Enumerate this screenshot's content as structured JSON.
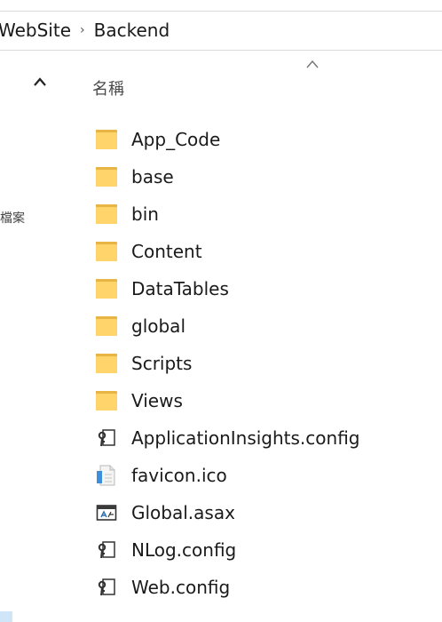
{
  "breadcrumb": {
    "items": [
      "WebSite",
      "Backend"
    ],
    "separator": "›"
  },
  "nav_pane": {
    "partial_text": "檔案",
    "scroll_up_icon": "chevron-up-icon"
  },
  "column": {
    "name_header": "名稱",
    "sort_icon": "sort-ascending-icon"
  },
  "files": [
    {
      "name": "App_Code",
      "type": "folder"
    },
    {
      "name": "base",
      "type": "folder"
    },
    {
      "name": "bin",
      "type": "folder"
    },
    {
      "name": "Content",
      "type": "folder"
    },
    {
      "name": "DataTables",
      "type": "folder"
    },
    {
      "name": "global",
      "type": "folder"
    },
    {
      "name": "Scripts",
      "type": "folder"
    },
    {
      "name": "Views",
      "type": "folder"
    },
    {
      "name": "ApplicationInsights.config",
      "type": "config"
    },
    {
      "name": "favicon.ico",
      "type": "icon-file"
    },
    {
      "name": "Global.asax",
      "type": "asax"
    },
    {
      "name": "NLog.config",
      "type": "config"
    },
    {
      "name": "Web.config",
      "type": "config"
    }
  ],
  "colors": {
    "folder": "#ffd46a",
    "folder_dark": "#e8b443",
    "divider": "#d9d9d9",
    "accent": "#cfe6f8"
  }
}
